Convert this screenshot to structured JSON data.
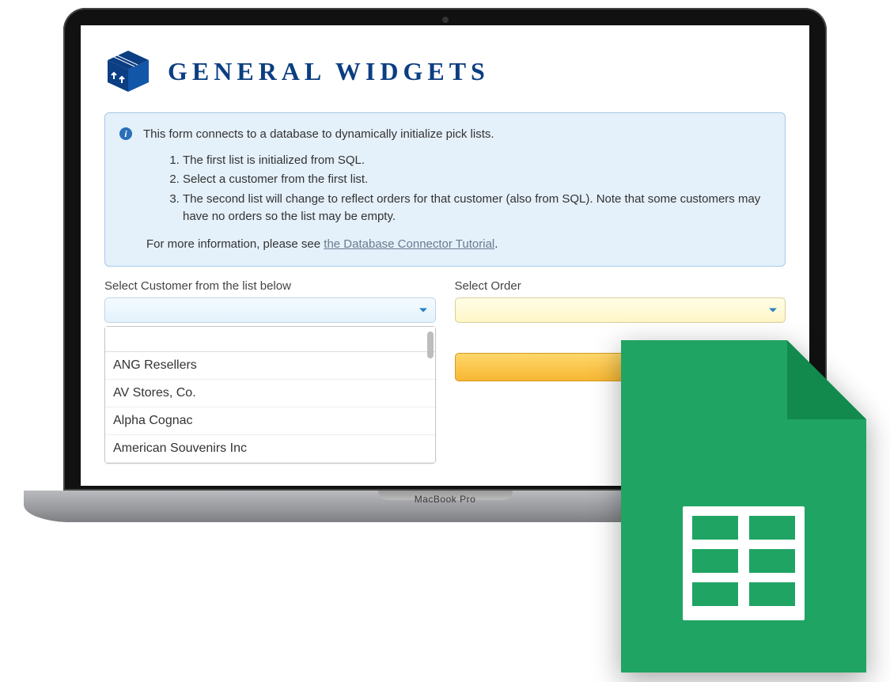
{
  "brand": {
    "title": "General Widgets"
  },
  "info": {
    "intro": "This form connects to a database to dynamically initialize pick lists.",
    "steps": [
      "The first list is initialized from SQL.",
      "Select a customer from the first list.",
      "The second list will change to reflect orders for that customer (also from SQL). Note that some customers may have no orders so the list may be empty."
    ],
    "more_prefix": "For more information, please see ",
    "more_link": "the Database Connector Tutorial",
    "more_suffix": "."
  },
  "form": {
    "customer_label": "Select Customer from the list below",
    "order_label": "Select Order",
    "customer_options": [
      "ANG Resellers",
      "AV Stores, Co.",
      "Alpha Cognac",
      "American Souvenirs Inc"
    ]
  },
  "device": {
    "label": "MacBook Pro"
  }
}
